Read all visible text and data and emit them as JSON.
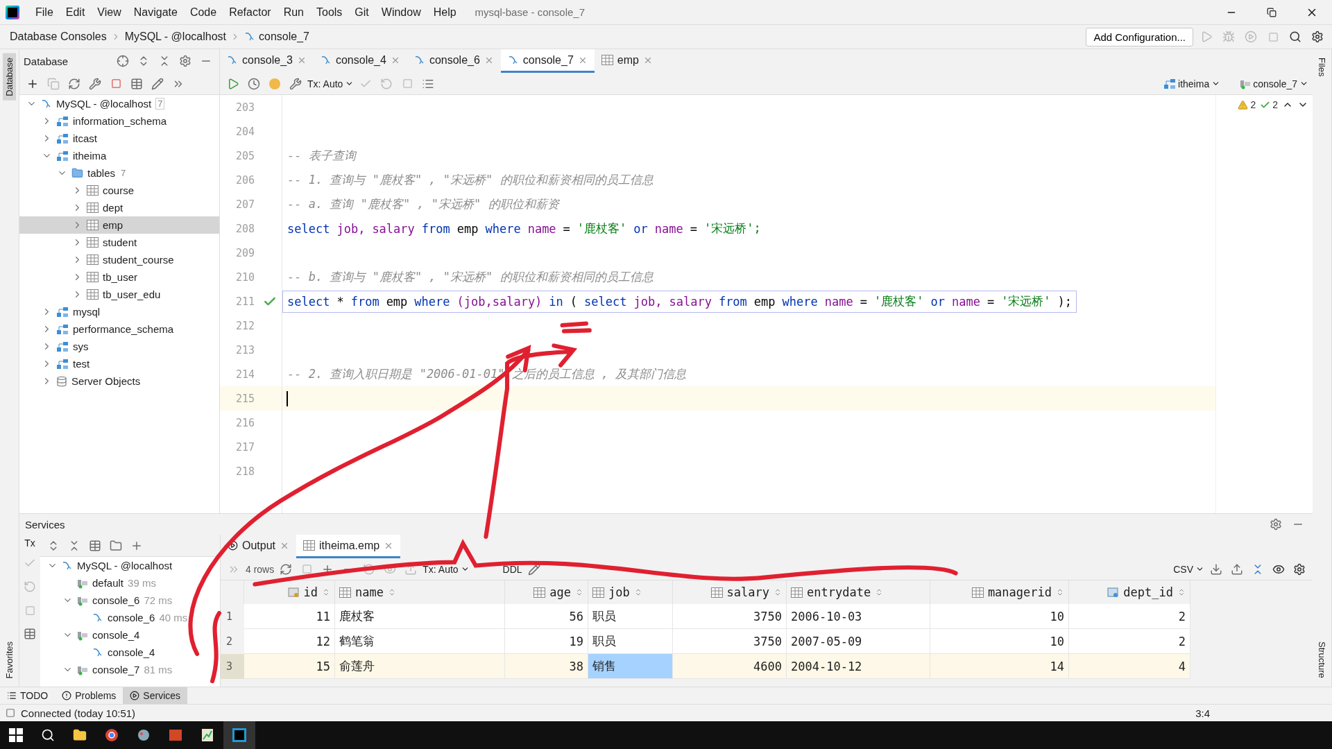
{
  "window": {
    "title": "mysql-base - console_7",
    "menu": [
      "File",
      "Edit",
      "View",
      "Navigate",
      "Code",
      "Refactor",
      "Run",
      "Tools",
      "Git",
      "Window",
      "Help"
    ]
  },
  "breadcrumb": [
    {
      "label": "Database Consoles",
      "kind": "plain"
    },
    {
      "label": "MySQL - @localhost",
      "kind": "plain"
    },
    {
      "label": "console_7",
      "kind": "console"
    }
  ],
  "run_toolbar": {
    "configuration": "Add Configuration..."
  },
  "side_stripes": {
    "left_top": "Database",
    "left_bottom": "Favorites",
    "right_top": "Files",
    "right_bottom": "Structure"
  },
  "database_panel": {
    "title": "Database",
    "tree": [
      {
        "kind": "connection",
        "label": "MySQL - @localhost",
        "count": "7",
        "expanded": true,
        "selected": false,
        "children": [
          {
            "kind": "schema",
            "label": "information_schema",
            "expanded": false,
            "selected": false
          },
          {
            "kind": "schema",
            "label": "itcast",
            "expanded": false,
            "selected": false
          },
          {
            "kind": "schema",
            "label": "itheima",
            "expanded": true,
            "selected": false,
            "children": [
              {
                "kind": "folder",
                "label": "tables",
                "count": "7",
                "expanded": true,
                "selected": false,
                "children": [
                  {
                    "kind": "table",
                    "label": "course",
                    "expanded": false,
                    "selected": false
                  },
                  {
                    "kind": "table",
                    "label": "dept",
                    "expanded": false,
                    "selected": false
                  },
                  {
                    "kind": "table",
                    "label": "emp",
                    "expanded": false,
                    "selected": true
                  },
                  {
                    "kind": "table",
                    "label": "student",
                    "expanded": false,
                    "selected": false
                  },
                  {
                    "kind": "table",
                    "label": "student_course",
                    "expanded": false,
                    "selected": false
                  },
                  {
                    "kind": "table",
                    "label": "tb_user",
                    "expanded": false,
                    "selected": false
                  },
                  {
                    "kind": "table",
                    "label": "tb_user_edu",
                    "expanded": false,
                    "selected": false
                  }
                ]
              }
            ]
          },
          {
            "kind": "schema",
            "label": "mysql",
            "expanded": false,
            "selected": false
          },
          {
            "kind": "schema",
            "label": "performance_schema",
            "expanded": false,
            "selected": false
          },
          {
            "kind": "schema",
            "label": "sys",
            "expanded": false,
            "selected": false
          },
          {
            "kind": "schema",
            "label": "test",
            "expanded": false,
            "selected": false
          },
          {
            "kind": "server",
            "label": "Server Objects",
            "expanded": false,
            "selected": false
          }
        ]
      }
    ]
  },
  "editor_tabs": [
    {
      "label": "console_3",
      "kind": "console",
      "selected": false
    },
    {
      "label": "console_4",
      "kind": "console",
      "selected": false
    },
    {
      "label": "console_6",
      "kind": "console",
      "selected": false
    },
    {
      "label": "console_7",
      "kind": "console",
      "selected": true
    },
    {
      "label": "emp",
      "kind": "table",
      "selected": false
    }
  ],
  "editor_toolbar": {
    "transaction": "Tx: Auto",
    "schema": "itheima",
    "session": "console_7"
  },
  "inspections": {
    "warnings": "2",
    "passed": "2"
  },
  "code_lines": [
    {
      "number": "203"
    },
    {
      "number": "204"
    },
    {
      "number": "205",
      "tokens": [
        {
          "kind": "comment",
          "text": "-- 表子查询"
        }
      ]
    },
    {
      "number": "206",
      "tokens": [
        {
          "kind": "comment",
          "text": "-- 1. 查询与 \"鹿杖客\" , \"宋远桥\" 的职位和薪资相同的员工信息"
        }
      ]
    },
    {
      "number": "207",
      "tokens": [
        {
          "kind": "comment",
          "text": "-- a. 查询 \"鹿杖客\" , \"宋远桥\" 的职位和薪资"
        }
      ]
    },
    {
      "number": "208",
      "tokens": [
        {
          "kind": "keyword",
          "text": "select"
        },
        {
          "kind": "column",
          "text": "job,"
        },
        {
          "kind": "column",
          "text": "salary"
        },
        {
          "kind": "keyword",
          "text": "from"
        },
        {
          "kind": "plain",
          "text": "emp"
        },
        {
          "kind": "keyword",
          "text": "where"
        },
        {
          "kind": "column",
          "text": "name"
        },
        {
          "kind": "plain",
          "text": "="
        },
        {
          "kind": "string",
          "text": "'鹿杖客'"
        },
        {
          "kind": "keyword",
          "text": "or"
        },
        {
          "kind": "column",
          "text": "name"
        },
        {
          "kind": "plain",
          "text": "="
        },
        {
          "kind": "string",
          "text": "'宋远桥';"
        }
      ]
    },
    {
      "number": "209"
    },
    {
      "number": "210",
      "tokens": [
        {
          "kind": "comment",
          "text": "-- b. 查询与 \"鹿杖客\" , \"宋远桥\" 的职位和薪资相同的员工信息"
        }
      ]
    },
    {
      "number": "211",
      "checked": true,
      "boxed": true,
      "tokens": [
        {
          "kind": "keyword",
          "text": "select"
        },
        {
          "kind": "plain",
          "text": "*"
        },
        {
          "kind": "keyword",
          "text": "from"
        },
        {
          "kind": "plain",
          "text": "emp"
        },
        {
          "kind": "keyword",
          "text": "where"
        },
        {
          "kind": "column",
          "text": "(job,salary)"
        },
        {
          "kind": "keyword",
          "text": "in"
        },
        {
          "kind": "plain",
          "text": "("
        },
        {
          "kind": "keyword",
          "text": "select"
        },
        {
          "kind": "column",
          "text": "job,"
        },
        {
          "kind": "column",
          "text": "salary"
        },
        {
          "kind": "keyword",
          "text": "from"
        },
        {
          "kind": "plain",
          "text": "emp"
        },
        {
          "kind": "keyword",
          "text": "where"
        },
        {
          "kind": "column",
          "text": "name"
        },
        {
          "kind": "plain",
          "text": "="
        },
        {
          "kind": "string",
          "text": "'鹿杖客'"
        },
        {
          "kind": "keyword",
          "text": "or"
        },
        {
          "kind": "column",
          "text": "name"
        },
        {
          "kind": "plain",
          "text": "="
        },
        {
          "kind": "string",
          "text": "'宋远桥'"
        },
        {
          "kind": "plain",
          "text": ");"
        }
      ]
    },
    {
      "number": "212"
    },
    {
      "number": "213"
    },
    {
      "number": "214",
      "tokens": [
        {
          "kind": "comment",
          "text": "-- 2. 查询入职日期是 \"2006-01-01\" 之后的员工信息 , 及其部门信息"
        }
      ]
    },
    {
      "number": "215",
      "current": true
    },
    {
      "number": "216"
    },
    {
      "number": "217"
    },
    {
      "number": "218"
    }
  ],
  "services": {
    "title": "Services",
    "tx": "Tx",
    "tree": [
      {
        "kind": "connection",
        "label": "MySQL - @localhost",
        "expanded": true,
        "children": [
          {
            "kind": "session",
            "label": "default",
            "time": "39 ms"
          },
          {
            "kind": "session",
            "label": "console_6",
            "time": "72 ms",
            "expanded": true,
            "children": [
              {
                "kind": "console",
                "label": "console_6",
                "time": "40 ms"
              }
            ]
          },
          {
            "kind": "session",
            "label": "console_4",
            "expanded": true,
            "children": [
              {
                "kind": "console",
                "label": "console_4"
              }
            ]
          },
          {
            "kind": "session",
            "label": "console_7",
            "time": "81 ms",
            "expanded": true
          }
        ]
      }
    ],
    "tabs": [
      {
        "label": "Output",
        "kind": "output",
        "selected": false
      },
      {
        "label": "itheima.emp",
        "kind": "table",
        "selected": true
      }
    ],
    "rows_count": "4 rows",
    "transaction": "Tx: Auto",
    "ddl": "DDL",
    "export_format": "CSV"
  },
  "result_table": {
    "columns": [
      {
        "name": "id",
        "kind": "key"
      },
      {
        "name": "name",
        "kind": "plain"
      },
      {
        "name": "age",
        "kind": "plain"
      },
      {
        "name": "job",
        "kind": "plain"
      },
      {
        "name": "salary",
        "kind": "plain"
      },
      {
        "name": "entrydate",
        "kind": "plain"
      },
      {
        "name": "managerid",
        "kind": "plain"
      },
      {
        "name": "dept_id",
        "kind": "foreign"
      }
    ],
    "rows": [
      {
        "number": "1",
        "selected": false,
        "cells": [
          {
            "text": "11",
            "selected": false
          },
          {
            "text": "鹿杖客",
            "selected": false
          },
          {
            "text": "56",
            "selected": false
          },
          {
            "text": "职员",
            "selected": false
          },
          {
            "text": "3750",
            "selected": false
          },
          {
            "text": "2006-10-03",
            "selected": false
          },
          {
            "text": "10",
            "selected": false
          },
          {
            "text": "2",
            "selected": false
          }
        ]
      },
      {
        "number": "2",
        "selected": false,
        "cells": [
          {
            "text": "12",
            "selected": false
          },
          {
            "text": "鹤笔翁",
            "selected": false
          },
          {
            "text": "19",
            "selected": false
          },
          {
            "text": "职员",
            "selected": false
          },
          {
            "text": "3750",
            "selected": false
          },
          {
            "text": "2007-05-09",
            "selected": false
          },
          {
            "text": "10",
            "selected": false
          },
          {
            "text": "2",
            "selected": false
          }
        ]
      },
      {
        "number": "3",
        "selected": true,
        "cells": [
          {
            "text": "15",
            "selected": false
          },
          {
            "text": "俞莲舟",
            "selected": false
          },
          {
            "text": "38",
            "selected": false
          },
          {
            "text": "销售",
            "selected": true
          },
          {
            "text": "4600",
            "selected": false
          },
          {
            "text": "2004-10-12",
            "selected": false
          },
          {
            "text": "14",
            "selected": false
          },
          {
            "text": "4",
            "selected": false
          }
        ]
      }
    ]
  },
  "tool_tabs": [
    {
      "label": "TODO",
      "kind": "todo",
      "selected": false
    },
    {
      "label": "Problems",
      "kind": "problems",
      "selected": false
    },
    {
      "label": "Services",
      "kind": "services",
      "selected": true
    }
  ],
  "status_bar": {
    "message": "Connected (today 10:51)",
    "position": "3:4"
  },
  "annotation": {
    "kind": "freehand"
  }
}
